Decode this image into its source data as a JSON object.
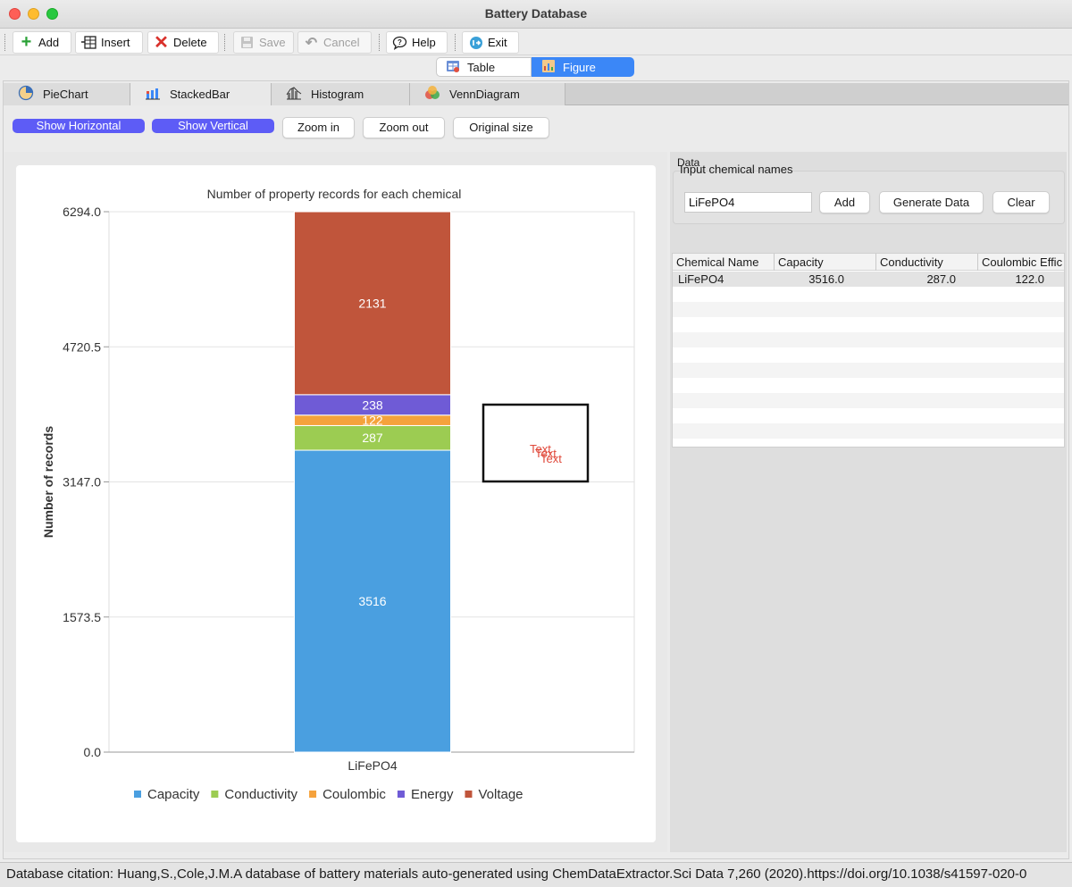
{
  "window": {
    "title": "Battery Database"
  },
  "toolbar": {
    "add": "Add",
    "insert": "Insert",
    "delete": "Delete",
    "save": "Save",
    "cancel": "Cancel",
    "help": "Help",
    "exit": "Exit"
  },
  "view_tabs": {
    "table": "Table",
    "figure": "Figure",
    "selected": "Figure"
  },
  "chart_tabs": [
    "PieChart",
    "StackedBar",
    "Histogram",
    "VennDiagram"
  ],
  "chart_tab_selected": "StackedBar",
  "controls": {
    "show_horizontal": "Show Horizontal",
    "show_vertical": "Show Vertical",
    "zoom_in": "Zoom in",
    "zoom_out": "Zoom out",
    "original_size": "Original size"
  },
  "colors": {
    "Capacity": "#4a9fe0",
    "Conductivity": "#9ccc52",
    "Coulombic": "#f5a23c",
    "Energy": "#6f5bd6",
    "Voltage": "#c0553b",
    "accent": "#5d5cf6",
    "selected_tab": "#3b87f7"
  },
  "chart_data": {
    "type": "bar",
    "stacked": true,
    "title": "Number of property records for each chemical",
    "xlabel": "",
    "ylabel": "Number of records",
    "categories": [
      "LiFePO4"
    ],
    "ylim": [
      0,
      6294.0
    ],
    "yticks": [
      "0.0",
      "1573.5",
      "3147.0",
      "4720.5",
      "6294.0"
    ],
    "series": [
      {
        "name": "Capacity",
        "values": [
          3516
        ]
      },
      {
        "name": "Conductivity",
        "values": [
          287
        ]
      },
      {
        "name": "Coulombic",
        "values": [
          122
        ]
      },
      {
        "name": "Energy",
        "values": [
          238
        ]
      },
      {
        "name": "Voltage",
        "values": [
          2131
        ]
      }
    ],
    "legend": "bottom",
    "grid": true,
    "annotation_box_texts": [
      "Text",
      "Text",
      "Text"
    ]
  },
  "data_panel": {
    "title": "Data",
    "input_group_title": "Input chemical names",
    "input_value": "LiFePO4",
    "add": "Add",
    "generate": "Generate Data",
    "clear": "Clear",
    "columns": [
      "Chemical Name",
      "Capacity",
      "Conductivity",
      "Coulombic Effic"
    ],
    "rows": [
      [
        "LiFePO4",
        "3516.0",
        "287.0",
        "122.0"
      ]
    ]
  },
  "status": {
    "citation": "Database citation:  Huang,S.,Cole,J.M.A database of battery materials auto-generated using ChemDataExtractor.Sci Data 7,260 (2020).https://doi.org/10.1038/s41597-020-0"
  }
}
